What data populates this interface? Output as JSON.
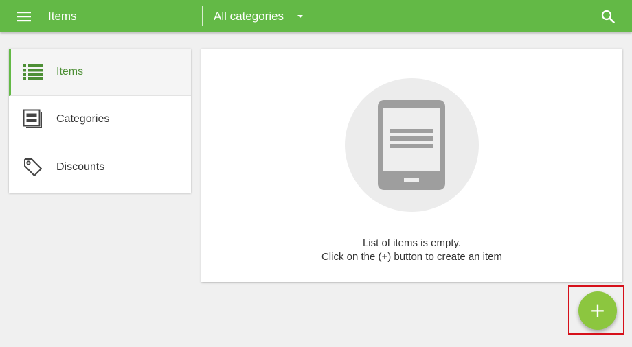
{
  "appbar": {
    "title": "Items",
    "category_filter": "All categories",
    "menu_icon": "hamburger-menu-icon",
    "search_icon": "search-icon",
    "color": "#63b946"
  },
  "sidebar": {
    "items": [
      {
        "label": "Items",
        "icon": "list-icon",
        "active": true
      },
      {
        "label": "Categories",
        "icon": "categories-icon",
        "active": false
      },
      {
        "label": "Discounts",
        "icon": "tag-icon",
        "active": false
      }
    ],
    "active_color": "#63b946"
  },
  "content": {
    "empty_icon": "tablet-icon",
    "empty_line1": "List of items is empty.",
    "empty_line2": "Click on the (+) button to create an item"
  },
  "fab": {
    "label": "+",
    "icon": "plus-icon",
    "color": "#8cc63f"
  },
  "highlight_color": "#d6101a"
}
